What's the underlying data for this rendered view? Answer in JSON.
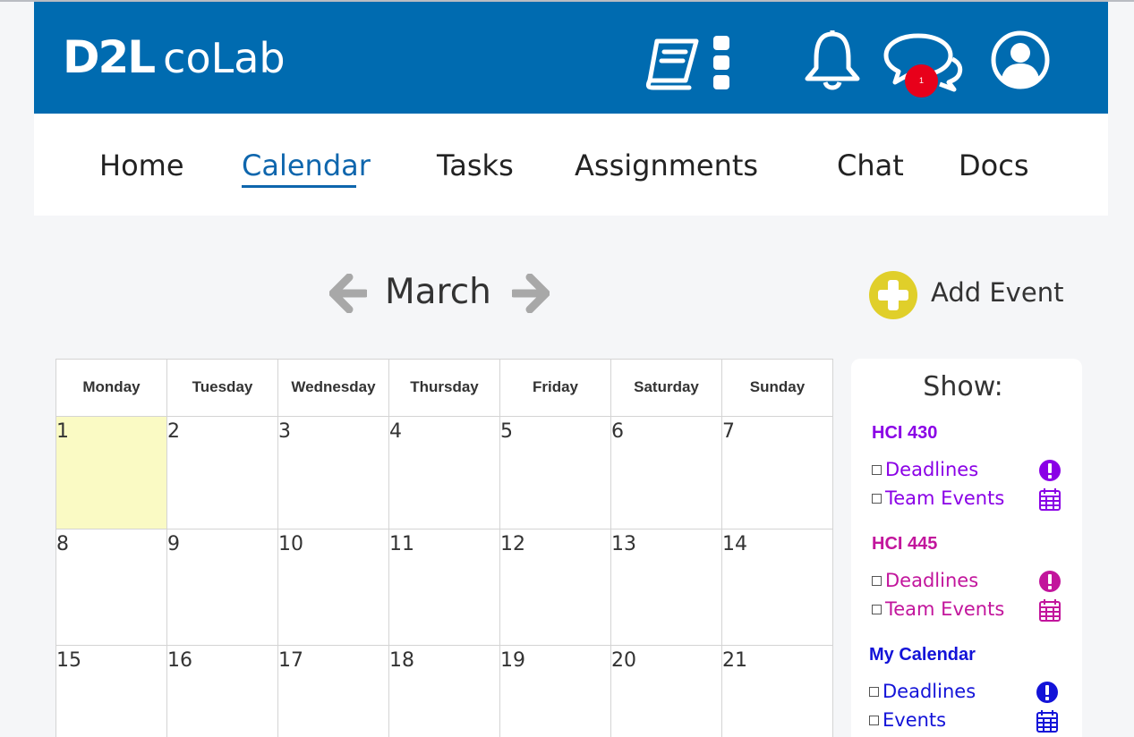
{
  "app": {
    "brand_strong": "D2L",
    "brand_light": "coLab",
    "notification_count": "1"
  },
  "nav": {
    "home": "Home",
    "calendar": "Calendar",
    "tasks": "Tasks",
    "assignments": "Assignments",
    "chat": "Chat",
    "docs": "Docs",
    "active": "Calendar"
  },
  "calendar": {
    "month": "March",
    "add_event": "Add Event",
    "weekdays": [
      "Monday",
      "Tuesday",
      "Wednesday",
      "Thursday",
      "Friday",
      "Saturday",
      "Sunday"
    ],
    "weeks": [
      [
        "1",
        "2",
        "3",
        "4",
        "5",
        "6",
        "7"
      ],
      [
        "8",
        "9",
        "10",
        "11",
        "12",
        "13",
        "14"
      ],
      [
        "15",
        "16",
        "17",
        "18",
        "19",
        "20",
        "21"
      ]
    ],
    "today": "1"
  },
  "sidebar": {
    "title": "Show:",
    "groups": [
      {
        "name": "HCI 430",
        "color": "#8a00e6",
        "items": [
          "Deadlines",
          "Team Events"
        ]
      },
      {
        "name": "HCI 445",
        "color": "#c2159c",
        "items": [
          "Deadlines",
          "Team Events"
        ]
      },
      {
        "name": "My Calendar",
        "color": "#1313d8",
        "items": [
          "Deadlines",
          "Events"
        ]
      }
    ]
  },
  "colors": {
    "header": "#006bb0",
    "accent": "#0e66ad",
    "add_button": "#e0cf2a",
    "badge": "#e8001a",
    "today": "#fafac4"
  }
}
